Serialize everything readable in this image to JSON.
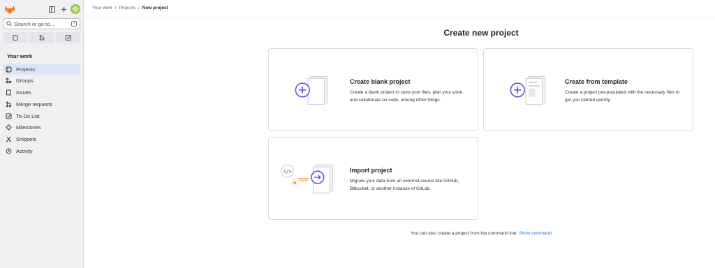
{
  "sidebar": {
    "search_placeholder": "Search or go to...",
    "search_shortcut": "/",
    "section_title": "Your work",
    "items": [
      {
        "label": "Projects"
      },
      {
        "label": "Groups"
      },
      {
        "label": "Issues"
      },
      {
        "label": "Merge requests"
      },
      {
        "label": "To-Do List"
      },
      {
        "label": "Milestones"
      },
      {
        "label": "Snippets"
      },
      {
        "label": "Activity"
      }
    ]
  },
  "breadcrumb": {
    "items": [
      "Your work",
      "Projects",
      "New project"
    ],
    "separator": "/"
  },
  "main": {
    "title": "Create new project",
    "cards": [
      {
        "title": "Create blank project",
        "description": "Create a blank project to store your files, plan your work, and collaborate on code, among other things."
      },
      {
        "title": "Create from template",
        "description": "Create a project pre-populated with the necessary files to get you started quickly."
      },
      {
        "title": "Import project",
        "description": "Migrate your data from an external source like GitHub, Bitbucket, or another instance of GitLab."
      }
    ],
    "cli_text": "You can also create a project from the command line.",
    "cli_link": "Show command"
  },
  "colors": {
    "accent_purple": "#6e49cb",
    "link_blue": "#1f75cb",
    "active_nav_bg": "#dbe7f6",
    "logo_orange": "#e24329"
  }
}
